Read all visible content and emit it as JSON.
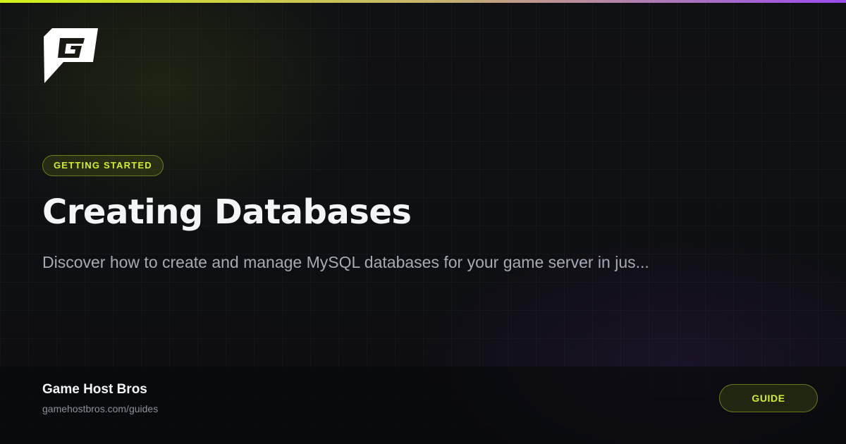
{
  "brand": {
    "logo_icon": "game-host-bros-g-logo-icon",
    "name": "Game Host Bros",
    "url": "gamehostbros.com/guides"
  },
  "category_badge": "GETTING STARTED",
  "title": "Creating Databases",
  "description": "Discover how to create and manage MySQL databases for your game server in jus...",
  "guide_button": "GUIDE",
  "colors": {
    "accent_lime": "#d4ef2a",
    "accent_purple": "#9a4cf0",
    "background": "#0e0f13",
    "title_text": "#f4f5f7",
    "description_text": "#a7aab3"
  }
}
